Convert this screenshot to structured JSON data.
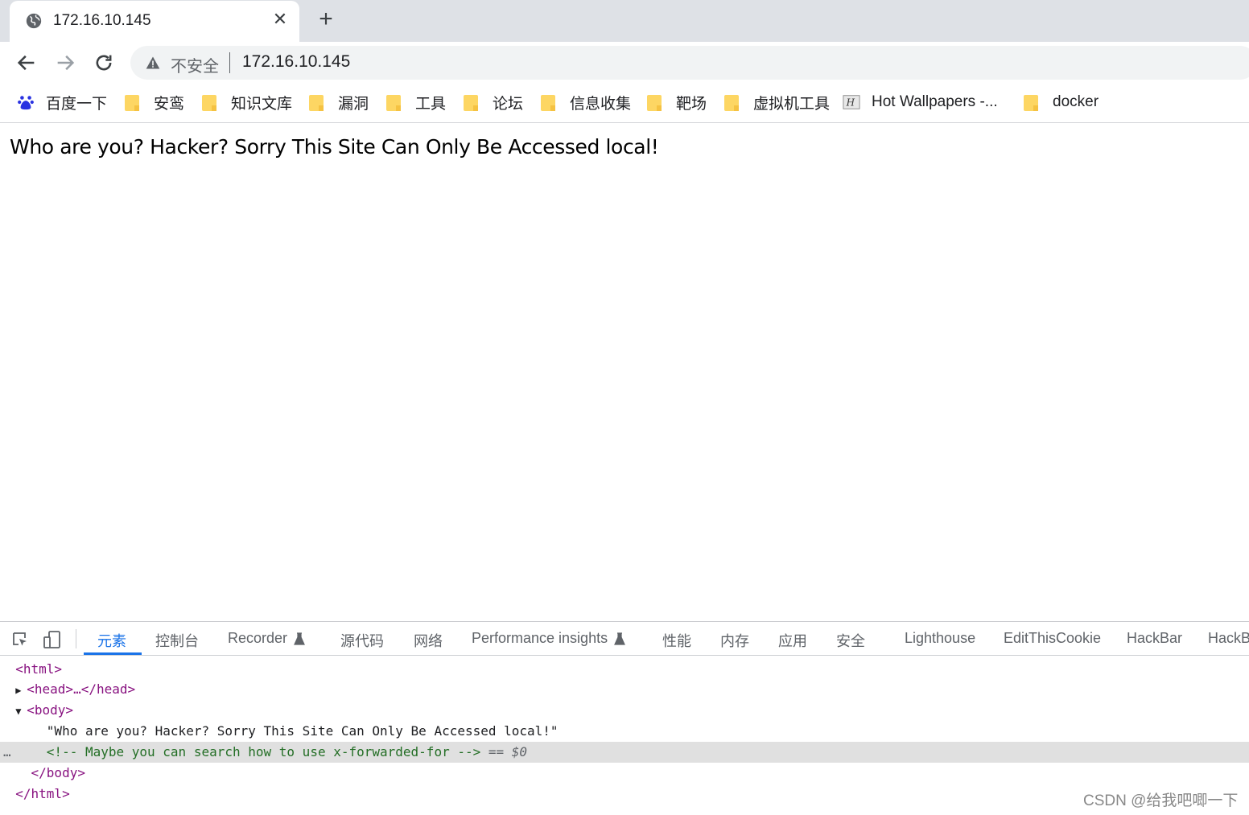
{
  "tab": {
    "title": "172.16.10.145",
    "icon": "globe-icon"
  },
  "toolbar": {
    "security_label": "不安全",
    "url": "172.16.10.145"
  },
  "bookmarks": [
    {
      "label": "百度一下",
      "icon": "baidu-paw-icon"
    },
    {
      "label": "安鸾",
      "icon": "folder-icon"
    },
    {
      "label": "知识文库",
      "icon": "folder-icon"
    },
    {
      "label": "漏洞",
      "icon": "folder-icon"
    },
    {
      "label": "工具",
      "icon": "folder-icon"
    },
    {
      "label": "论坛",
      "icon": "folder-icon"
    },
    {
      "label": "信息收集",
      "icon": "folder-icon"
    },
    {
      "label": "靶场",
      "icon": "folder-icon"
    },
    {
      "label": "虚拟机工具",
      "icon": "folder-icon"
    },
    {
      "label": "Hot Wallpapers -...",
      "icon": "site-favicon-icon"
    },
    {
      "label": "docker",
      "icon": "folder-icon"
    }
  ],
  "page": {
    "message": "Who are you? Hacker? Sorry This Site Can Only Be Accessed local!"
  },
  "devtools": {
    "tabs": [
      "元素",
      "控制台",
      "Recorder",
      "源代码",
      "网络",
      "Performance insights",
      "性能",
      "内存",
      "应用",
      "安全",
      "Lighthouse",
      "EditThisCookie",
      "HackBar",
      "HackB"
    ],
    "active_tab": "元素",
    "dom": {
      "html_open": "<html>",
      "head": "<head>…</head>",
      "body_open": "<body>",
      "body_text": "\"Who are you? Hacker? Sorry This Site Can Only Be Accessed local!\"",
      "comment": "<!-- Maybe you can search how to use x-forwarded-for -->",
      "selected_marker": "== $0",
      "body_close": "</body>",
      "html_close": "</html>",
      "row_menu": "…"
    }
  },
  "watermark": "CSDN @给我吧唧一下",
  "colors": {
    "accent": "#1a73e8",
    "tag": "#881280",
    "comment": "#236e25",
    "folder": "#fdd663"
  }
}
